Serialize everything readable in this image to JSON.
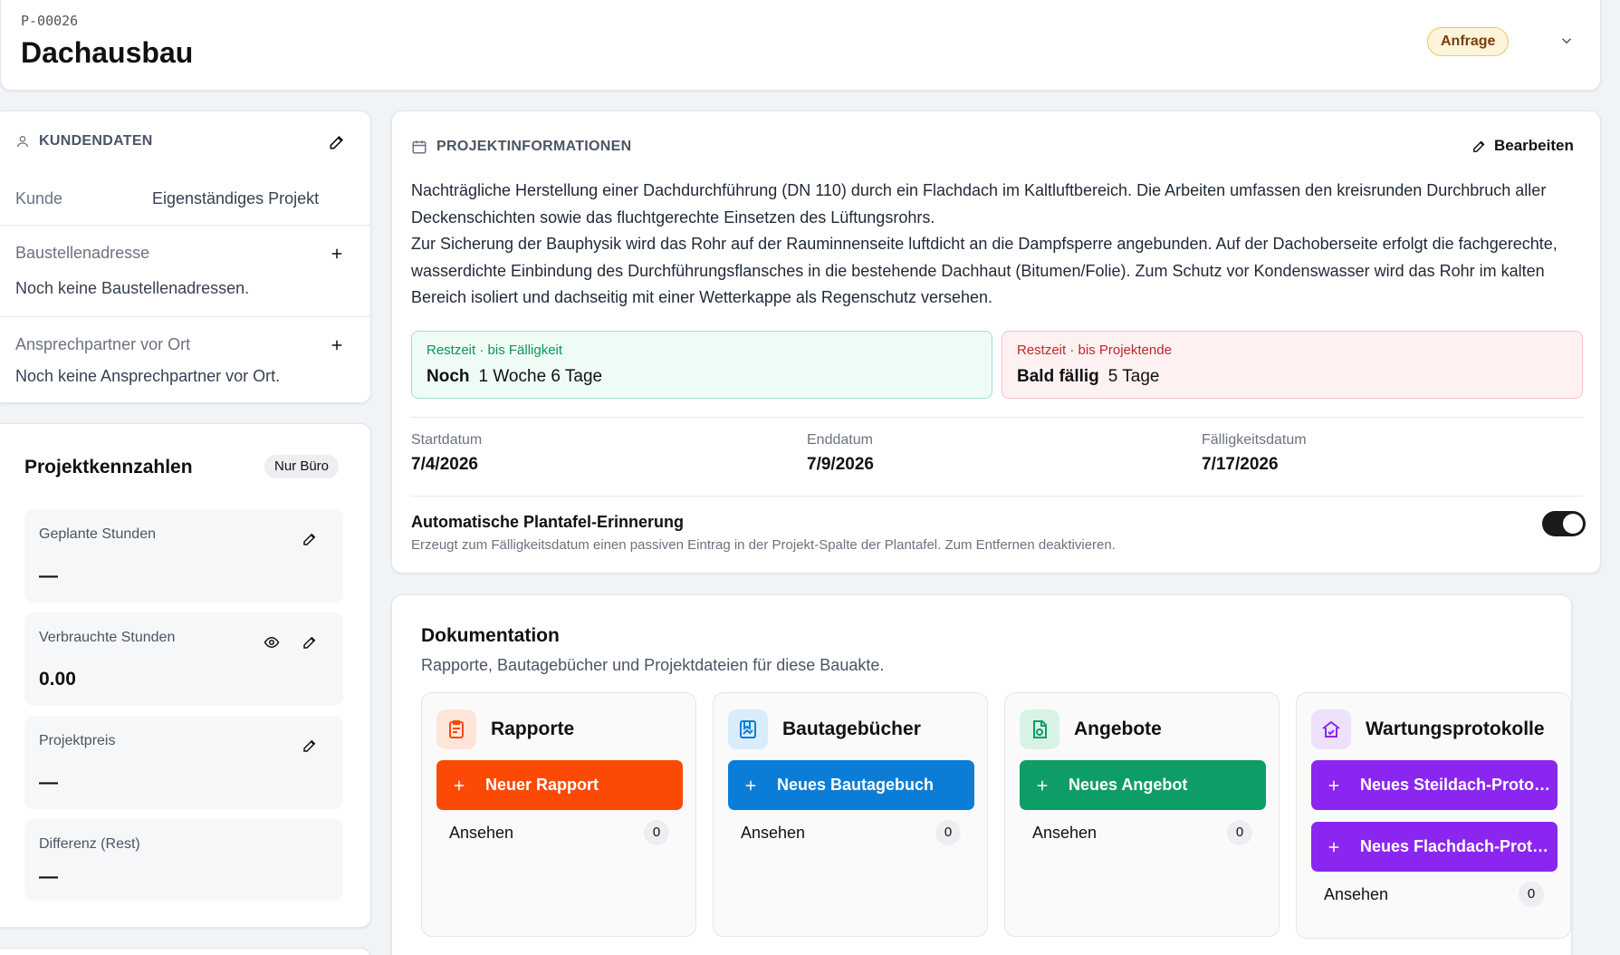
{
  "header": {
    "project_id": "P-00026",
    "title": "Dachausbau",
    "status": "Anfrage"
  },
  "customer": {
    "heading": "KUNDENDATEN",
    "customer_label": "Kunde",
    "customer_value": "Eigenständiges Projekt",
    "site_label": "Baustellenadresse",
    "site_empty": "Noch keine Baustellenadressen.",
    "contact_label": "Ansprechpartner vor Ort",
    "contact_empty": "Noch keine Ansprechpartner vor Ort."
  },
  "kpis": {
    "title": "Projektkennzahlen",
    "badge": "Nur Büro",
    "items": [
      {
        "label": "Geplante Stunden",
        "value": "—"
      },
      {
        "label": "Verbrauchte Stunden",
        "value": "0.00"
      },
      {
        "label": "Projektpreis",
        "value": "—"
      },
      {
        "label": "Differenz (Rest)",
        "value": "—"
      }
    ]
  },
  "project_info": {
    "heading": "PROJEKTINFORMATIONEN",
    "edit_label": "Bearbeiten",
    "description_1": "Nachträgliche Herstellung einer Dachdurchführung (DN 110) durch ein Flachdach im Kaltluftbereich. Die Arbeiten umfassen den kreisrunden Durchbruch aller Deckenschichten sowie das fluchtgerechte Einsetzen des Lüftungsrohrs.",
    "description_2": "Zur Sicherung der Bauphysik wird das Rohr auf der Rauminnenseite luftdicht an die Dampfsperre angebunden. Auf der Dachoberseite erfolgt die fachgerechte, wasserdichte Einbindung des Durchführungsflansches in die bestehende Dachhaut (Bitumen/Folie). Zum Schutz vor Kondenswasser wird das Rohr im kalten Bereich isoliert und dachseitig mit einer Wetterkappe als Regenschutz versehen.",
    "remaining_due": {
      "label": "Restzeit · bis Fälligkeit",
      "prefix": "Noch",
      "value": "1 Woche 6 Tage"
    },
    "remaining_end": {
      "label": "Restzeit · bis Projektende",
      "prefix": "Bald fällig",
      "value": "5 Tage"
    },
    "start_label": "Startdatum",
    "start_value": "7/4/2026",
    "end_label": "Enddatum",
    "end_value": "7/9/2026",
    "due_label": "Fälligkeitsdatum",
    "due_value": "7/17/2026",
    "reminder_title": "Automatische Plantafel-Erinnerung",
    "reminder_desc": "Erzeugt zum Fälligkeitsdatum einen passiven Eintrag in der Projekt-Spalte der Plantafel. Zum Entfernen deaktivieren.",
    "reminder_on": true
  },
  "documentation": {
    "title": "Dokumentation",
    "subtitle": "Rapporte, Bautagebücher und Projektdateien für diese Bauakte.",
    "view_label": "Ansehen",
    "columns": [
      {
        "title": "Rapporte",
        "button": "Neuer Rapport",
        "count": "0",
        "color": "#fb4a06",
        "icon": "report-icon"
      },
      {
        "title": "Bautagebücher",
        "button": "Neues Bautagebuch",
        "count": "0",
        "color": "#0b7dd6",
        "icon": "diary-icon"
      },
      {
        "title": "Angebote",
        "button": "Neues Angebot",
        "count": "0",
        "color": "#0f9d67",
        "icon": "offer-icon"
      },
      {
        "title": "Wartungsprotokolle",
        "button": "Neues Steildach-Proto…",
        "button2": "Neues Flachdach-Prot…",
        "count": "0",
        "color": "#8b26f0",
        "icon": "maintenance-icon"
      }
    ]
  }
}
